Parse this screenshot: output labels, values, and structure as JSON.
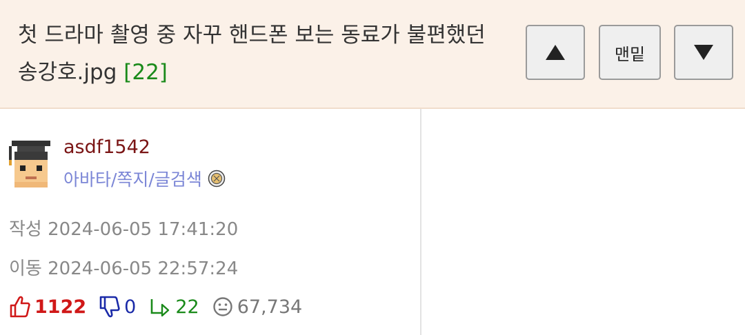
{
  "header": {
    "title": "첫 드라마 촬영 중 자꾸 핸드폰 보는 동료가 불편했던 송강호.jpg",
    "comment_count": "[22]",
    "buttons": {
      "up_icon": "triangle-up-icon",
      "bottom_label": "맨밑",
      "down_icon": "triangle-down-icon"
    }
  },
  "author": {
    "username": "asdf1542",
    "links": "아바타/쪽지/글검색",
    "avatar_icon": "graduate-avatar",
    "badge_icon": "medal-icon"
  },
  "meta": {
    "created": "작성 2024-06-05 17:41:20",
    "moved": "이동 2024-06-05 22:57:24"
  },
  "stats": {
    "upvotes": "1122",
    "downvotes": "0",
    "replies": "22",
    "views": "67,734"
  },
  "colors": {
    "header_bg": "#fbf1e8",
    "username": "#7a1414",
    "links": "#7b86d6",
    "upvote": "#d01818",
    "downvote": "#1a2aa8",
    "reply": "#1a8a1a"
  }
}
